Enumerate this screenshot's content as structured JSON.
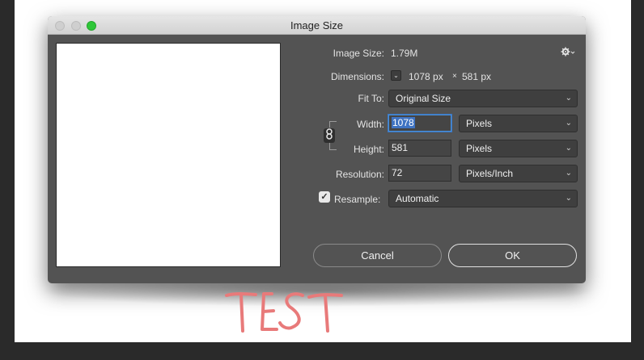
{
  "window": {
    "title": "Image Size"
  },
  "image_size": {
    "label": "Image Size:",
    "value": "1.79M"
  },
  "dimensions": {
    "label": "Dimensions:",
    "width_value": "1078 px",
    "times": "×",
    "height_value": "581 px"
  },
  "fit_to": {
    "label": "Fit To:",
    "selected": "Original Size"
  },
  "width": {
    "label": "Width:",
    "value": "1078",
    "unit": "Pixels"
  },
  "height": {
    "label": "Height:",
    "value": "581",
    "unit": "Pixels"
  },
  "resolution": {
    "label": "Resolution:",
    "value": "72",
    "unit": "Pixels/Inch"
  },
  "resample": {
    "label": "Resample:",
    "checked": true,
    "selected": "Automatic"
  },
  "buttons": {
    "cancel": "Cancel",
    "ok": "OK"
  },
  "overlay_text": "TEST",
  "icons": {
    "settings": "gear-icon",
    "constrain": "chain-link-icon",
    "dropdown": "chevron-down-icon"
  }
}
